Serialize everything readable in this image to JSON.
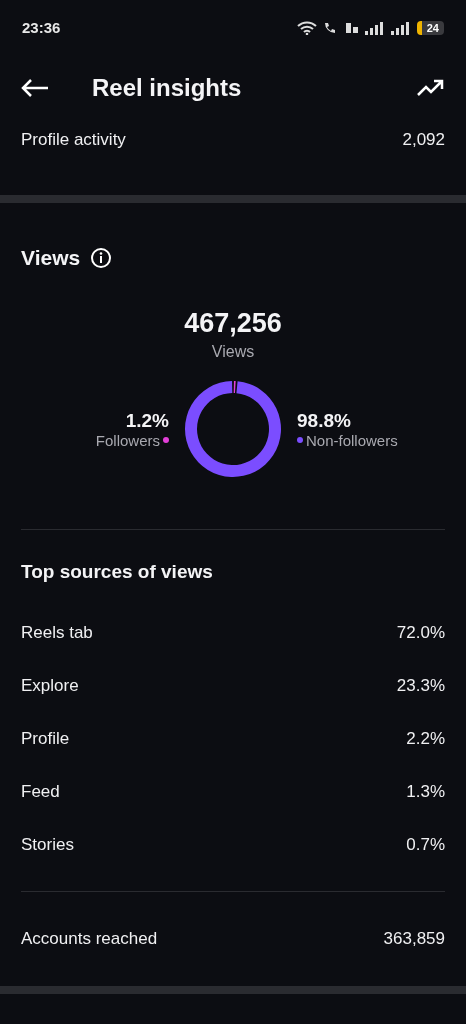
{
  "status_bar": {
    "time": "23:36",
    "battery": "24"
  },
  "header": {
    "title": "Reel insights"
  },
  "profile_activity": {
    "label": "Profile activity",
    "value": "2,092"
  },
  "views": {
    "title": "Views",
    "total": "467,256",
    "total_label": "Views",
    "segments": [
      {
        "share": "1.2%",
        "color": "#e23fd8"
      },
      {
        "share": "98.8%",
        "color": "#7b4dff"
      }
    ],
    "chart_data": {
      "type": "donut",
      "categories": [
        "Followers",
        "Non-followers"
      ],
      "values": [
        1.2,
        98.8
      ]
    }
  },
  "top_sources": {
    "title": "Top sources of views",
    "rows": [
      {
        "label": "Reels tab",
        "value": "72.0%"
      },
      {
        "label": "Explore",
        "value": "23.3%"
      },
      {
        "label": "Profile",
        "value": "2.2%"
      },
      {
        "label": "Feed",
        "value": "1.3%"
      },
      {
        "label": "Stories",
        "value": "0.7%"
      }
    ]
  },
  "accounts_reached": {
    "label": "Accounts reached",
    "value": "363,859"
  }
}
